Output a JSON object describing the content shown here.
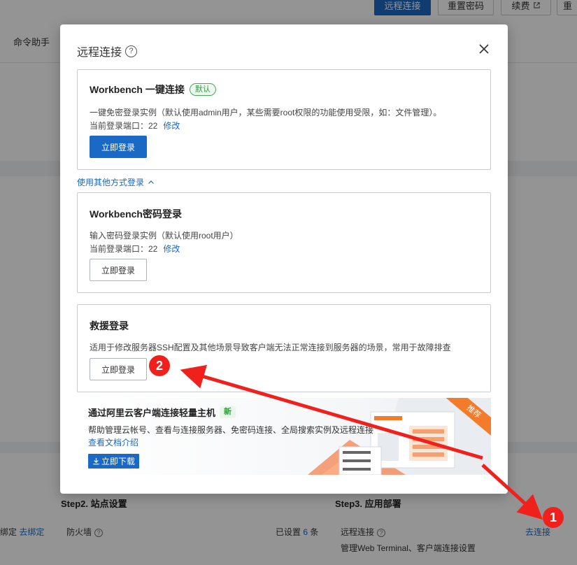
{
  "background": {
    "top_buttons": [
      {
        "label": "远程连接",
        "primary": true
      },
      {
        "label": "重置密码",
        "primary": false
      },
      {
        "label": "续费",
        "primary": false
      },
      {
        "label": "重",
        "primary": false
      }
    ],
    "tab_label": "命令助手",
    "step2_title": "Step2. 站点设置",
    "step3_title": "Step3. 应用部署",
    "bind_prefix": "绑定",
    "bind_link": "去绑定",
    "firewall_label": "防火墙",
    "firewall_status_prefix": "已设置",
    "firewall_count": "6",
    "firewall_unit": "条",
    "remote_label": "远程连接",
    "remote_desc": "管理Web Terminal、客户端连接设置",
    "connect_link": "去连接"
  },
  "modal": {
    "title": "远程连接",
    "workbench_card": {
      "title": "Workbench 一键连接",
      "badge": "默认",
      "desc": "一键免密登录实例（默认使用admin用户，某些需要root权限的功能使用受限，如：文件管理）。",
      "port_label": "当前登录端口：22",
      "edit_label": "修改",
      "button_label": "立即登录"
    },
    "other_methods_label": "使用其他方式登录",
    "password_card": {
      "title": "Workbench密码登录",
      "desc": "输入密码登录实例（默认使用root用户）",
      "port_label": "当前登录端口：22",
      "edit_label": "修改",
      "button_label": "立即登录"
    },
    "rescue_card": {
      "title": "救援登录",
      "desc": "适用于修改服务器SSH配置及其他场景导致客户端无法正常连接到服务器的场景，常用于故障排查",
      "button_label": "立即登录"
    },
    "promo": {
      "title": "通过阿里云客户端连接轻量主机",
      "new_badge": "新",
      "desc": "帮助管理云帐号、查看与连接服务器、免密码连接、全局搜索实例及远程连接",
      "doc_link": "查看文档介绍",
      "download_label": "立即下载",
      "ribbon_label": "推荐"
    }
  },
  "annotations": {
    "marker_1": "1",
    "marker_2": "2",
    "arrow_color": "#f0211d"
  },
  "colors": {
    "brand_blue": "#1a69c4",
    "success_green": "#2e9e3c",
    "ribbon_orange": "#f37b2a"
  }
}
